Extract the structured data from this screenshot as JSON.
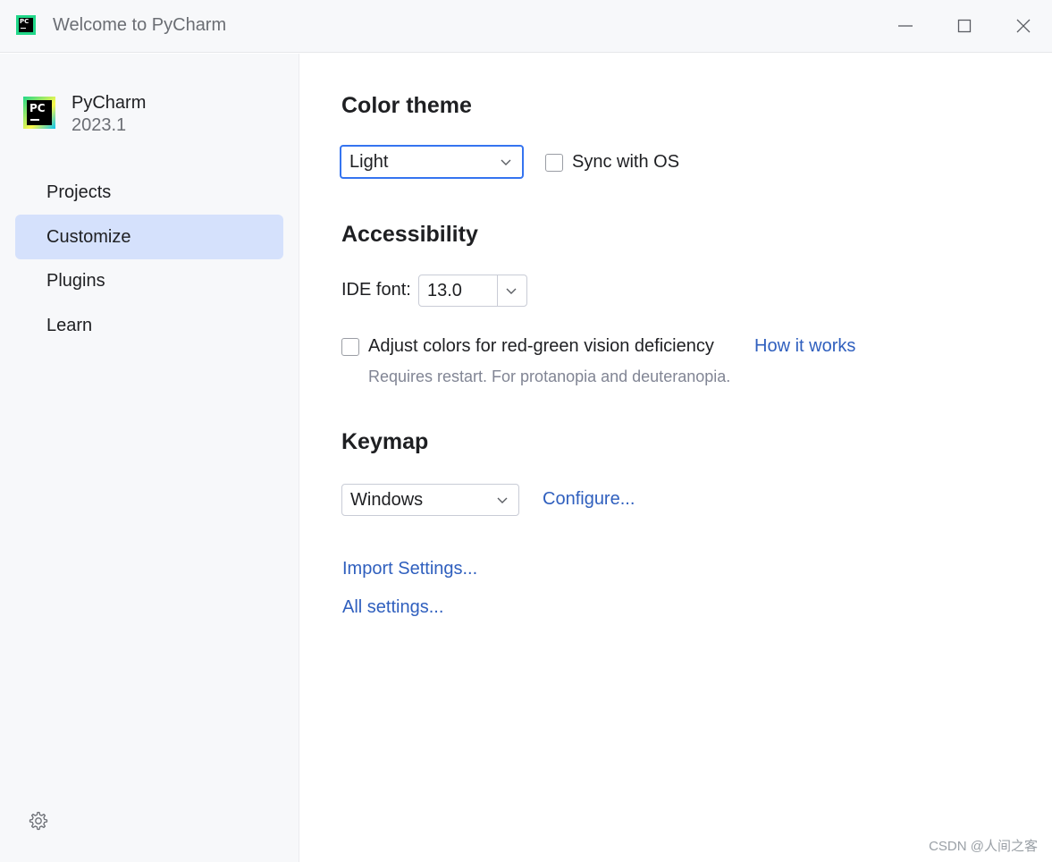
{
  "window": {
    "title": "Welcome to PyCharm",
    "app_icon": "pycharm-logo"
  },
  "sidebar": {
    "product_name": "PyCharm",
    "product_version": "2023.1",
    "items": [
      {
        "label": "Projects",
        "selected": false
      },
      {
        "label": "Customize",
        "selected": true
      },
      {
        "label": "Plugins",
        "selected": false
      },
      {
        "label": "Learn",
        "selected": false
      }
    ],
    "settings_icon": "gear-icon"
  },
  "customize": {
    "color_theme": {
      "title": "Color theme",
      "selected": "Light",
      "sync_label": "Sync with OS",
      "sync_checked": false
    },
    "accessibility": {
      "title": "Accessibility",
      "font_label": "IDE font:",
      "font_value": "13.0",
      "color_adjust_label": "Adjust colors for red-green vision deficiency",
      "color_adjust_checked": false,
      "how_it_works": "How it works",
      "hint": "Requires restart. For protanopia and deuteranopia."
    },
    "keymap": {
      "title": "Keymap",
      "selected": "Windows",
      "configure": "Configure..."
    },
    "import_settings": "Import Settings...",
    "all_settings": "All settings..."
  },
  "watermark": "CSDN @人间之客",
  "colors": {
    "selection": "#d5e1fc",
    "link": "#2f5fbe",
    "focus": "#3574f0"
  }
}
